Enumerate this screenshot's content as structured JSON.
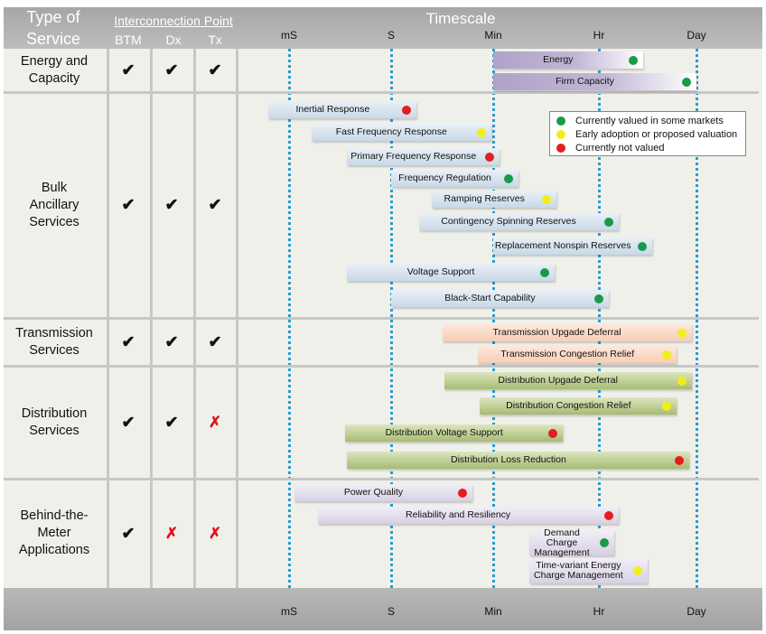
{
  "chart_data": {
    "type": "table",
    "title": "Timescale",
    "header": {
      "type_of_service": "Type of Service",
      "type_of_service_lines": [
        "Type of",
        "Service"
      ],
      "interconnection_point": "Interconnection Point",
      "interconnection_columns": [
        "BTM",
        "Dx",
        "Tx"
      ],
      "timescale": "Timescale"
    },
    "timescale_ticks": [
      "mS",
      "S",
      "Min",
      "Hr",
      "Day"
    ],
    "legend": [
      {
        "key": "green",
        "label": "Currently valued in some markets",
        "color": "#1a9a48"
      },
      {
        "key": "yellow",
        "label": "Early adoption or proposed valuation",
        "color": "#f2ee1b"
      },
      {
        "key": "red",
        "label": "Currently not valued",
        "color": "#e41d1d"
      }
    ],
    "categories": [
      {
        "name": "Energy and Capacity",
        "lines": [
          "Energy and",
          "Capacity"
        ],
        "style": "energy",
        "interconnection": {
          "BTM": true,
          "Dx": true,
          "Tx": true
        },
        "services": [
          {
            "label": "Energy",
            "start": 2.0,
            "end": 3.45,
            "status": "green"
          },
          {
            "label": "Firm Capacity",
            "start": 2.0,
            "end": 4.0,
            "status": "green"
          }
        ]
      },
      {
        "name": "Bulk Ancillary Services",
        "lines": [
          "Bulk",
          "Ancillary",
          "Services"
        ],
        "style": "bulk",
        "interconnection": {
          "BTM": true,
          "Dx": true,
          "Tx": true
        },
        "services": [
          {
            "label": "Inertial Response",
            "start": -0.2,
            "end": 1.25,
            "status": "red"
          },
          {
            "label": "Fast Frequency Response",
            "start": 0.22,
            "end": 1.98,
            "status": "yellow"
          },
          {
            "label": "Primary Frequency Response",
            "start": 0.57,
            "end": 2.06,
            "status": "red"
          },
          {
            "label": "Frequency Regulation",
            "start": 1.0,
            "end": 2.24,
            "status": "green"
          },
          {
            "label": "Ramping Reserves",
            "start": 1.4,
            "end": 2.6,
            "status": "yellow"
          },
          {
            "label": "Contingency Spinning Reserves",
            "start": 1.27,
            "end": 3.2,
            "status": "green"
          },
          {
            "label": "Replacement Nonspin Reserves",
            "start": 2.0,
            "end": 3.55,
            "status": "green"
          },
          {
            "label": "Voltage Support",
            "start": 0.57,
            "end": 2.58,
            "status": "green"
          },
          {
            "label": "Black-Start Capability",
            "start": 1.0,
            "end": 3.1,
            "status": "green"
          }
        ]
      },
      {
        "name": "Transmission Services",
        "lines": [
          "Transmission",
          "Services"
        ],
        "style": "trans",
        "interconnection": {
          "BTM": true,
          "Dx": true,
          "Tx": true
        },
        "services": [
          {
            "label": "Transmission Upgade Deferral",
            "start": 1.5,
            "end": 3.95,
            "status": "yellow"
          },
          {
            "label": "Transmission Congestion Relief",
            "start": 1.85,
            "end": 3.8,
            "status": "yellow"
          }
        ]
      },
      {
        "name": "Distribution Services",
        "lines": [
          "Distribution",
          "Services"
        ],
        "style": "dist",
        "interconnection": {
          "BTM": true,
          "Dx": true,
          "Tx": false
        },
        "services": [
          {
            "label": "Distribution Upgade Deferral",
            "start": 1.52,
            "end": 3.95,
            "status": "yellow"
          },
          {
            "label": "Distribution Congestion Relief",
            "start": 1.87,
            "end": 3.8,
            "status": "yellow"
          },
          {
            "label": "Distribution Voltage Support",
            "start": 0.55,
            "end": 2.66,
            "status": "red"
          },
          {
            "label": "Distribution Loss Reduction",
            "start": 0.57,
            "end": 3.93,
            "status": "red"
          }
        ]
      },
      {
        "name": "Behind-the-Meter Applications",
        "lines": [
          "Behind-the-",
          "Meter",
          "Applications"
        ],
        "style": "btm",
        "interconnection": {
          "BTM": true,
          "Dx": false,
          "Tx": false
        },
        "services": [
          {
            "label": "Power Quality",
            "start": 0.05,
            "end": 1.8,
            "status": "red"
          },
          {
            "label": "Reliability and Resiliency",
            "start": 0.28,
            "end": 3.2,
            "status": "red"
          },
          {
            "label": "Demand Charge Management",
            "lines": [
              "Demand Charge",
              "Management"
            ],
            "start": 2.34,
            "end": 3.16,
            "status": "green"
          },
          {
            "label": "Time-variant Energy Charge Management",
            "lines": [
              "Time-variant Energy",
              "Charge Management"
            ],
            "start": 2.34,
            "end": 3.5,
            "status": "yellow"
          }
        ]
      }
    ]
  },
  "marks": {
    "yes": "✔",
    "no": "✗"
  }
}
